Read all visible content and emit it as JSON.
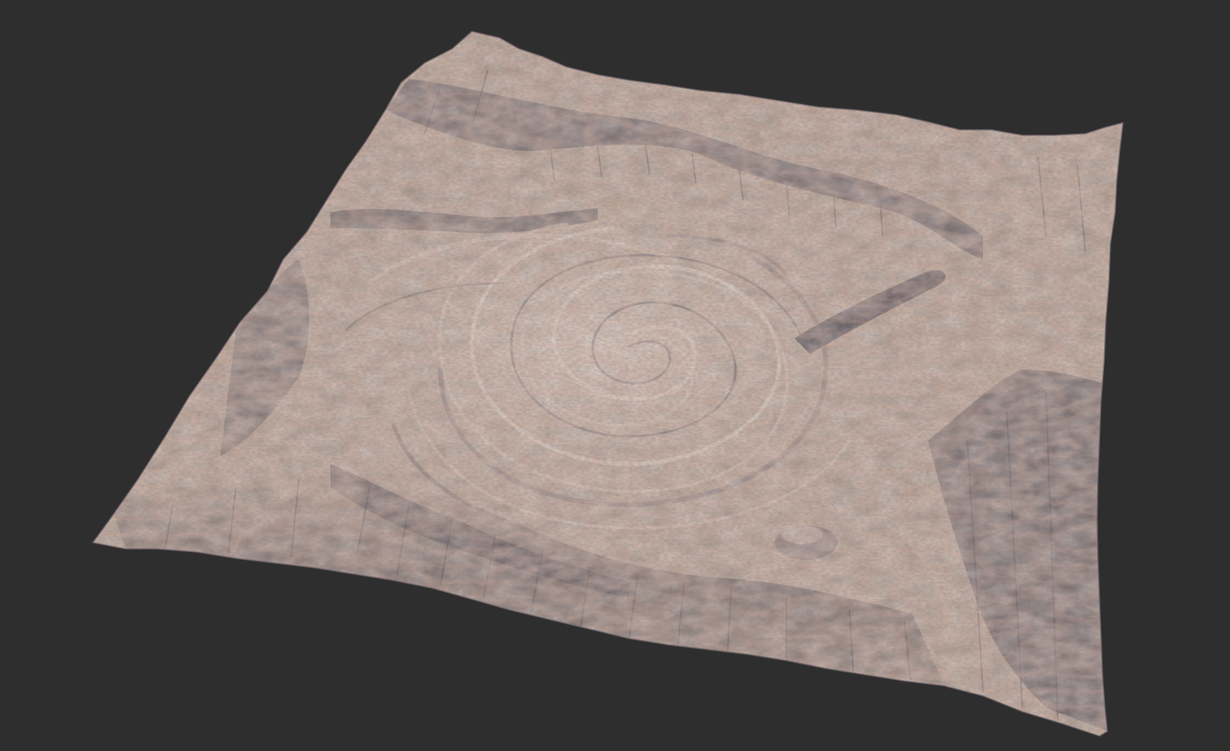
{
  "scene": {
    "background_color": "#2e2e2e",
    "subject": "terrain-mesh",
    "palette": {
      "rock_light": "#c9b8ab",
      "rock_mid": "#9a8578",
      "rock_dark": "#4e4750",
      "rock_shadow": "#2f2c33",
      "rust": "#b07a62",
      "dust": "#d6c6b8"
    }
  }
}
